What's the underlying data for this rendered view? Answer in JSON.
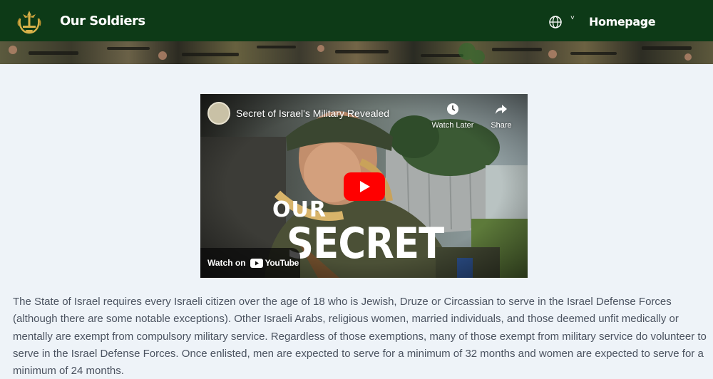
{
  "header": {
    "site_title": "Our Soldiers",
    "homepage_label": "Homepage",
    "background_color": "#0d3a17",
    "icons": {
      "logo": "idf-emblem-icon",
      "language": "globe-icon",
      "language_menu": "chevron-down-icon",
      "homepage_arrow": "chevron-right-icon"
    }
  },
  "video": {
    "title": "Secret of Israel's Military Revealed",
    "watch_later_label": "Watch Later",
    "share_label": "Share",
    "watch_on_label": "Watch on",
    "youtube_label": "YouTube",
    "overlay_line1": "OUR",
    "overlay_line2": "SECRET",
    "play_button_color": "#ff0000"
  },
  "article": {
    "paragraph": "The State of Israel requires every Israeli citizen over the age of 18 who is Jewish, Druze or Circassian to serve in the Israel Defense Forces (although there are some notable exceptions). Other Israeli Arabs, religious women, married individuals, and those deemed unfit medically or mentally are exempt from compulsory military service. Regardless of those exemptions, many of those exempt from military service do volunteer to serve in the Israel Defense Forces. Once enlisted, men are expected to serve for a minimum of 32 months and women are expected to serve for a minimum of 24 months."
  }
}
